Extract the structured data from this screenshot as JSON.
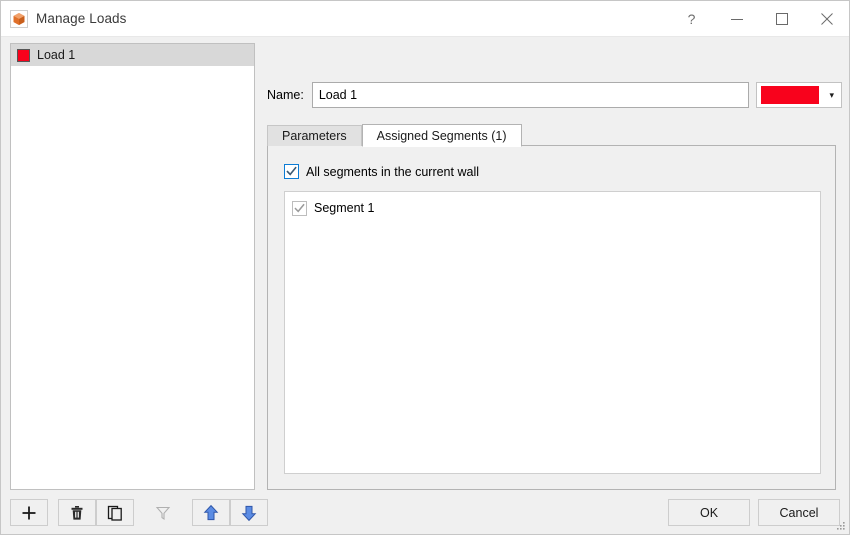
{
  "window": {
    "title": "Manage Loads",
    "icon": "cube-icon",
    "controls": [
      {
        "name": "help-button",
        "glyph": "?"
      },
      {
        "name": "minimize-button",
        "glyph": "—"
      },
      {
        "name": "maximize-button",
        "glyph": "□"
      },
      {
        "name": "close-button",
        "glyph": "✕"
      }
    ]
  },
  "loads_list": {
    "items": [
      {
        "label": "Load 1",
        "color": "#f8021c",
        "selected": true
      }
    ]
  },
  "left_toolbar": {
    "buttons": [
      {
        "name": "add-load-button",
        "icon": "plus-icon",
        "enabled": true
      },
      {
        "name": "delete-load-button",
        "icon": "trash-icon",
        "enabled": true
      },
      {
        "name": "duplicate-load-button",
        "icon": "duplicate-icon",
        "enabled": true
      },
      {
        "name": "filter-button",
        "icon": "filter-icon",
        "enabled": false
      },
      {
        "name": "move-up-button",
        "icon": "arrow-up-icon",
        "enabled": true
      },
      {
        "name": "move-down-button",
        "icon": "arrow-down-icon",
        "enabled": true
      }
    ]
  },
  "name_row": {
    "label": "Name:",
    "value": "Load 1",
    "placeholder": "",
    "color_value": "#f8021c",
    "caret": "▾"
  },
  "tabs": [
    {
      "label": "Parameters",
      "active": false
    },
    {
      "label": "Assigned Segments (1)",
      "active": true
    }
  ],
  "assigned_segments": {
    "all_segments": {
      "label": "All segments in the current wall",
      "checked": true,
      "enabled": true
    },
    "segments": [
      {
        "label": "Segment 1",
        "checked": true,
        "enabled": false
      }
    ]
  },
  "dialog_buttons": [
    {
      "name": "ok-button",
      "label": "OK"
    },
    {
      "name": "cancel-button",
      "label": "Cancel"
    }
  ]
}
